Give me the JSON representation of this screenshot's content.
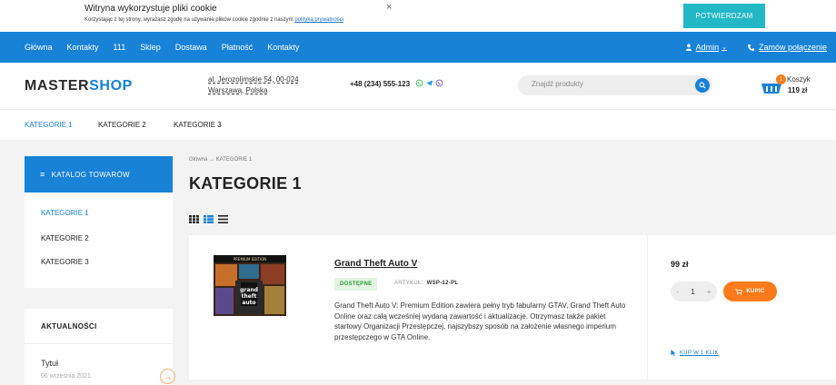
{
  "cookie": {
    "title": "Witryna wykorzystuje pliki cookie",
    "text": "Korzystając z tej strony, wyrażasz zgodę na używanie plików cookie zgodnie z naszym ",
    "link": "polityką prywatności",
    "confirm": "POTWIERDZAM",
    "close": "×"
  },
  "topnav": {
    "items": [
      "Główna",
      "Kontakty",
      "111",
      "Sklep",
      "Dostawa",
      "Płatność",
      "Kontakty"
    ],
    "admin": "Admin",
    "call": "Zamów połączenie"
  },
  "header": {
    "logo_a": "MASTER",
    "logo_b": "SHOP",
    "address_1": "al. Jerozolimskie 54, 00-024",
    "address_2": "Warszawa, Polska",
    "phone": "+48 (234) 555-123",
    "search_placeholder": "Znajdź produkty",
    "cart_label": "Koszyk",
    "cart_total": "119 zł",
    "cart_count": "1"
  },
  "catnav": {
    "items": [
      "KATEGORIE 1",
      "KATEGORIE 2",
      "KATEGORIE 3"
    ]
  },
  "sidebar": {
    "catalog_title": "KATALOG TOWARÓW",
    "items": [
      "KATEGORIE 1",
      "KATEGORIE 2",
      "KATEGORIE 3"
    ],
    "news_title": "AKTUALNOŚCI",
    "news_item": "Tytuł",
    "news_date": "06 września 2021"
  },
  "main": {
    "breadcrumb": "Główna → KATEGORIE 1",
    "title": "KATEGORIE 1"
  },
  "product": {
    "name": "Grand Theft Auto V",
    "stock": "DOSTĘPNE",
    "sku_label": "ARTYKUŁ:",
    "sku": "WSP-12-PL",
    "description": "Grand Theft Auto V: Premium Edition zawiera pełny tryb fabularny GTAV, Grand Theft Auto Online oraz całą wcześniej wydaną zawartość i aktualizacje. Otrzymasz także pakiet startowy Organizacji Przestępczej, najszybszy sposób na założenie własnego imperium przestępczego w GTA Online.",
    "price": "99 zł",
    "qty": "1",
    "qty_minus": "-",
    "qty_plus": "+",
    "buy": "KUPIĆ",
    "oneclick": "KUP W 1 KLIK",
    "image_text": "PREMIUM EDITION"
  },
  "colors": {
    "primary": "#1782d6",
    "accent": "#ff7a1a",
    "teal": "#22b8c6"
  }
}
